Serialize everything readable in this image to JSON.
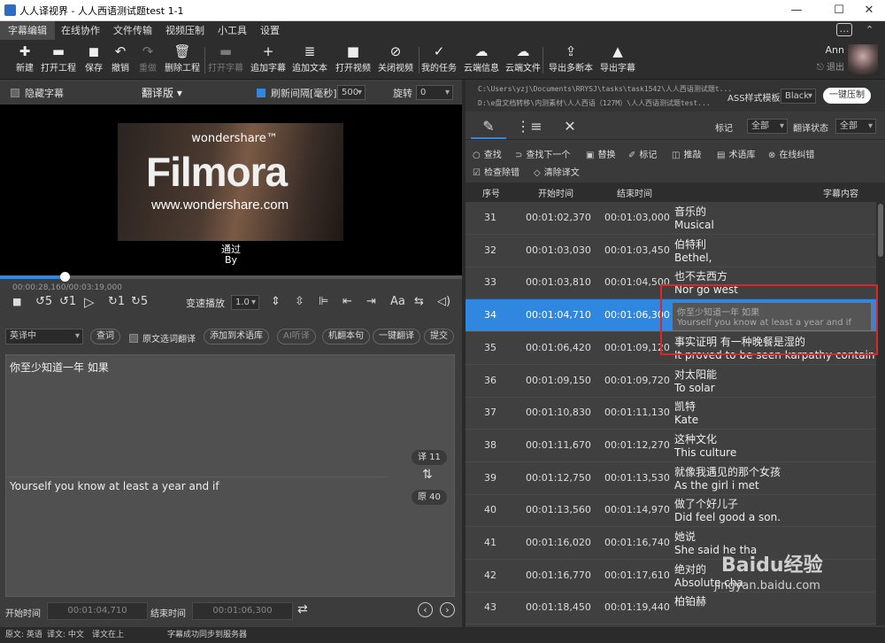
{
  "window": {
    "title": "人人译视界 - 人人西语测试题test 1-1"
  },
  "menu": [
    "字幕编辑",
    "在线协作",
    "文件传输",
    "视频压制",
    "小工具",
    "设置"
  ],
  "toolbar": [
    {
      "label": "新建",
      "icon": "new-icon",
      "glyph": "✚",
      "disabled": false
    },
    {
      "label": "打开工程",
      "icon": "folder-open-icon",
      "glyph": "▬",
      "disabled": false
    },
    {
      "label": "保存",
      "icon": "save-icon",
      "glyph": "◼",
      "disabled": false
    },
    {
      "label": "撤销",
      "icon": "undo-icon",
      "glyph": "↶",
      "disabled": false
    },
    {
      "label": "重做",
      "icon": "redo-icon",
      "glyph": "↷",
      "disabled": true
    },
    {
      "label": "删除工程",
      "icon": "trash-icon",
      "glyph": "🗑",
      "disabled": false
    },
    {
      "label": "打开字幕",
      "icon": "open-subtitle-icon",
      "glyph": "▬",
      "disabled": true
    },
    {
      "label": "追加字幕",
      "icon": "plus-icon",
      "glyph": "+",
      "disabled": false
    },
    {
      "label": "追加文本",
      "icon": "text-icon",
      "glyph": "≣",
      "disabled": false
    },
    {
      "label": "打开视频",
      "icon": "video-camera-icon",
      "glyph": "■",
      "disabled": false
    },
    {
      "label": "关闭视频",
      "icon": "video-off-icon",
      "glyph": "⊘",
      "disabled": false
    },
    {
      "label": "我的任务",
      "icon": "task-icon",
      "glyph": "✓",
      "disabled": false
    },
    {
      "label": "云端信息",
      "icon": "cloud-icon",
      "glyph": "☁",
      "disabled": false
    },
    {
      "label": "云端文件",
      "icon": "cloud-upload-icon",
      "glyph": "☁",
      "disabled": false
    },
    {
      "label": "导出多断本",
      "icon": "export-multi-icon",
      "glyph": "⇪",
      "disabled": false
    },
    {
      "label": "导出字幕",
      "icon": "export-subtitle-icon",
      "glyph": "▲",
      "disabled": false
    }
  ],
  "user": {
    "name": "Ann",
    "logout": "退出"
  },
  "left": {
    "hide_subtitle": "隐藏字幕",
    "version": "翻译版",
    "refresh_label": "刷新间隔[毫秒]",
    "refresh_value": "500",
    "rotate_label": "旋转",
    "rotate_value": "0",
    "video_watermark_top": "wondershare™",
    "video_watermark_logo": "Filmora",
    "video_watermark_url": "www.wondershare.com",
    "sub_line1": "通过",
    "sub_line2": "By",
    "time": "00:00:28,160/00:03:19,000",
    "progress": 0.14,
    "speed_label": "变速播放",
    "speed_value": "1.0",
    "lang": "英译中",
    "btn_lookup": "查词",
    "source_select": "原文选词翻译",
    "btn_add_term": "添加到术语库",
    "btn_ai": "AI听译",
    "btn_machine": "机翻本句",
    "btn_onekey": "一键翻译",
    "btn_submit": "提交",
    "translation_text": "你至少知道一年  如果",
    "source_text": "Yourself you know at least a year and if",
    "count_trans": "译 11",
    "count_orig": "原 40",
    "start_label": "开始时间",
    "start_value": "00:01:04,710",
    "end_label": "结束时间",
    "end_value": "00:01:06,300"
  },
  "right": {
    "path1": "C:\\Users\\yzj\\Documents\\RRYSJ\\tasks\\task1542\\人人西语测试题t...",
    "path2": "D:\\e盘文档转移\\内测素材\\人人西语（127M）\\人人西语测试题test...",
    "ass_label": "ASS样式模板",
    "ass_value": "Black",
    "compress_btn": "一键压制",
    "mark_label": "标记",
    "mark_value": "全部",
    "status_label": "翻译状态",
    "status_value": "全部",
    "tools": [
      {
        "label": "查找",
        "icon": "search-icon",
        "glyph": "○"
      },
      {
        "label": "查找下一个",
        "icon": "find-next-icon",
        "glyph": "⊃"
      },
      {
        "label": "替换",
        "icon": "replace-icon",
        "glyph": "▣"
      },
      {
        "label": "标记",
        "icon": "pin-icon",
        "glyph": "✐"
      },
      {
        "label": "推敲",
        "icon": "refine-icon",
        "glyph": "◫"
      },
      {
        "label": "术语库",
        "icon": "glossary-icon",
        "glyph": "▤"
      },
      {
        "label": "在线纠错",
        "icon": "online-fix-icon",
        "glyph": "⊗"
      },
      {
        "label": "检查除错",
        "icon": "check-icon",
        "glyph": "☑"
      },
      {
        "label": "清除译文",
        "icon": "eraser-icon",
        "glyph": "◇"
      }
    ],
    "headers": {
      "no": "序号",
      "start": "开始时间",
      "end": "结束时间",
      "content": "字幕内容"
    },
    "rows": [
      {
        "no": "31",
        "start": "00:01:02,370",
        "end": "00:01:03,000",
        "zh": "音乐的",
        "en": "Musical"
      },
      {
        "no": "32",
        "start": "00:01:03,030",
        "end": "00:01:03,450",
        "zh": "伯特利",
        "en": "Bethel,"
      },
      {
        "no": "33",
        "start": "00:01:03,810",
        "end": "00:01:04,500",
        "zh": "也不去西方",
        "en": "Nor go west"
      },
      {
        "no": "34",
        "start": "00:01:04,710",
        "end": "00:01:06,300",
        "zh": "",
        "en": ""
      },
      {
        "no": "35",
        "start": "00:01:06,420",
        "end": "00:01:09,120",
        "zh": "事实证明  有一种晚餐是湿的",
        "en": "It proved to be seen karpathy contain a"
      },
      {
        "no": "36",
        "start": "00:01:09,150",
        "end": "00:01:09,720",
        "zh": "对太阳能",
        "en": "To solar"
      },
      {
        "no": "37",
        "start": "00:01:10,830",
        "end": "00:01:11,130",
        "zh": "凯特",
        "en": "Kate"
      },
      {
        "no": "38",
        "start": "00:01:11,670",
        "end": "00:01:12,270",
        "zh": "这种文化",
        "en": "This culture"
      },
      {
        "no": "39",
        "start": "00:01:12,750",
        "end": "00:01:13,530",
        "zh": "就像我遇见的那个女孩",
        "en": "As the girl i met"
      },
      {
        "no": "40",
        "start": "00:01:13,560",
        "end": "00:01:14,970",
        "zh": "做了个好儿子",
        "en": "Did feel good a son."
      },
      {
        "no": "41",
        "start": "00:01:16,020",
        "end": "00:01:16,740",
        "zh": "她说",
        "en": "She said he tha"
      },
      {
        "no": "42",
        "start": "00:01:16,770",
        "end": "00:01:17,610",
        "zh": "绝对的",
        "en": "Absolute cha"
      },
      {
        "no": "43",
        "start": "00:01:18,450",
        "end": "00:01:19,440",
        "zh": "柏铂赫",
        "en": ""
      }
    ],
    "popup_zh": "你至少知道一年  如果",
    "popup_en": "Yourself you know at least a year and if"
  },
  "status": {
    "src": "原文: 英语",
    "trans": "译文: 中文",
    "pos": "译文在上",
    "msg": "字幕成功同步到服务器"
  },
  "watermark": {
    "brand": "Baidu经验",
    "url": "jingyan.baidu.com"
  }
}
